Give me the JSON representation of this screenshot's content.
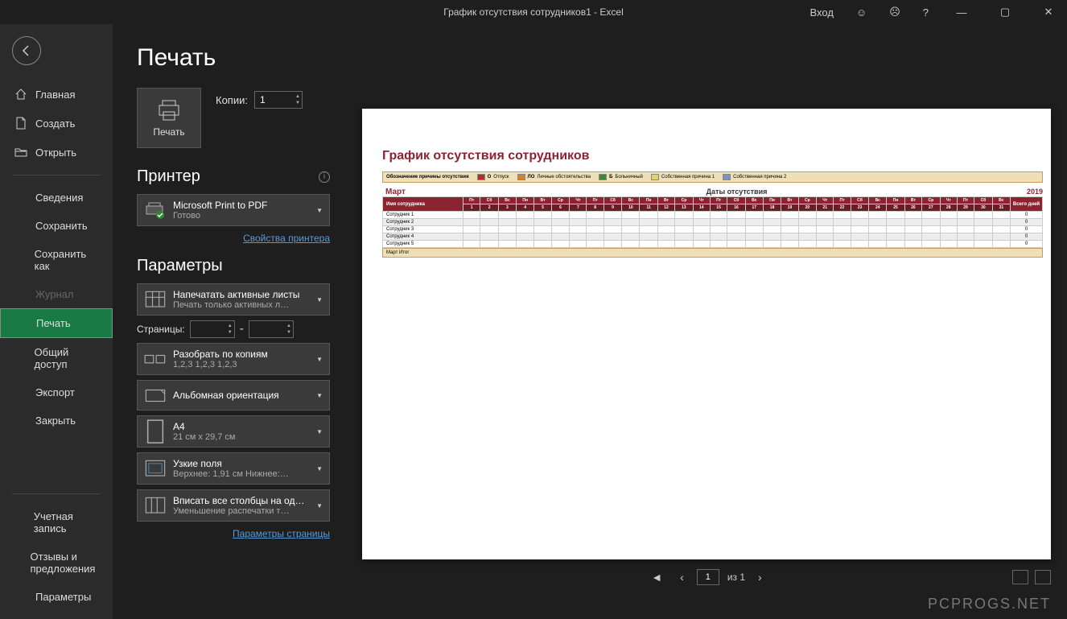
{
  "titlebar": {
    "title": "График отсутствия сотрудников1 - Excel",
    "login": "Вход",
    "help": "?"
  },
  "sidebar": {
    "home": "Главная",
    "new": "Создать",
    "open": "Открыть",
    "info": "Сведения",
    "save": "Сохранить",
    "saveas": "Сохранить как",
    "history": "Журнал",
    "print": "Печать",
    "share": "Общий доступ",
    "export": "Экспорт",
    "close": "Закрыть",
    "account": "Учетная запись",
    "feedback": "Отзывы и предложения",
    "options": "Параметры"
  },
  "page": {
    "title": "Печать",
    "print_btn": "Печать",
    "copies_label": "Копии:",
    "copies_value": "1",
    "printer_section": "Принтер",
    "printer_name": "Microsoft Print to PDF",
    "printer_status": "Готово",
    "printer_props": "Свойства принтера",
    "params_section": "Параметры",
    "active_sheets_l1": "Напечатать активные листы",
    "active_sheets_l2": "Печать только активных л…",
    "pages_label": "Страницы:",
    "pages_from": "",
    "pages_to": "",
    "collate_l1": "Разобрать по копиям",
    "collate_l2": "1,2,3    1,2,3    1,2,3",
    "orientation": "Альбомная ориентация",
    "paper_l1": "A4",
    "paper_l2": "21 см x 29,7 см",
    "margins_l1": "Узкие поля",
    "margins_l2": "Верхнее: 1,91 см Нижнее:…",
    "scaling_l1": "Вписать все столбцы на од…",
    "scaling_l2": "Уменьшение распечатки т…",
    "page_setup": "Параметры страницы"
  },
  "preview": {
    "doc_title": "График отсутствия сотрудников",
    "legend_title": "Обозначение причины отсутствия",
    "legend": [
      {
        "code": "О",
        "label": "Отпуск",
        "color": "#b03030"
      },
      {
        "code": "ЛО",
        "label": "Личные обстоятельства",
        "color": "#d08030"
      },
      {
        "code": "Б",
        "label": "Больничный",
        "color": "#3a8a3a"
      },
      {
        "code": "",
        "label": "Собственная причина 1",
        "color": "#e0d070"
      },
      {
        "code": "",
        "label": "Собственная причина 2",
        "color": "#8090c0"
      }
    ],
    "month": "Март",
    "dates_title": "Даты отсутствия",
    "year": "2019",
    "emp_header": "Имя сотрудника",
    "total_header": "Всего дней",
    "weekdays": [
      "Пт",
      "Сб",
      "Вс",
      "Пн",
      "Вт",
      "Ср",
      "Чт",
      "Пт",
      "Сб",
      "Вс",
      "Пн",
      "Вт",
      "Ср",
      "Чт",
      "Пт",
      "Сб",
      "Вс",
      "Пн",
      "Вт",
      "Ср",
      "Чт",
      "Пт",
      "Сб",
      "Вс",
      "Пн",
      "Вт",
      "Ср",
      "Чт",
      "Пт",
      "Сб",
      "Вс"
    ],
    "days": [
      "1",
      "2",
      "3",
      "4",
      "5",
      "6",
      "7",
      "8",
      "9",
      "10",
      "11",
      "12",
      "13",
      "14",
      "15",
      "16",
      "17",
      "18",
      "19",
      "20",
      "21",
      "22",
      "23",
      "24",
      "25",
      "26",
      "27",
      "28",
      "29",
      "30",
      "31"
    ],
    "employees": [
      {
        "name": "Сотрудник 1",
        "total": "0"
      },
      {
        "name": "Сотрудник 2",
        "total": "0"
      },
      {
        "name": "Сотрудник 3",
        "total": "0"
      },
      {
        "name": "Сотрудник 4",
        "total": "0"
      },
      {
        "name": "Сотрудник 5",
        "total": "0"
      }
    ],
    "summary": "Март Итог"
  },
  "footer": {
    "page_current": "1",
    "page_of": "из 1"
  },
  "watermark": "PCPROGS.NET"
}
